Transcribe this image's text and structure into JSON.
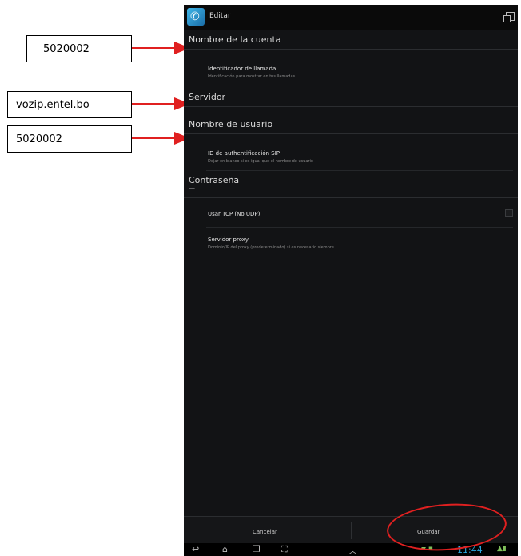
{
  "callouts": [
    {
      "text": "5020002"
    },
    {
      "text": "vozip.entel.bo"
    },
    {
      "text": "5020002"
    }
  ],
  "action_bar": {
    "title": "Editar",
    "icon": "phone-app-icon"
  },
  "categories": {
    "account_name": "Nombre de la cuenta",
    "server": "Servidor",
    "username": "Nombre de usuario",
    "password": "Contraseña",
    "password_value": "—"
  },
  "preferences": {
    "caller_id": {
      "title": "Identificador de llamada",
      "summary": "Identificación para mostrar en tus llamadas"
    },
    "sip_auth": {
      "title": "ID de authentificación SIP",
      "summary": "Dejar en blanco si es igual que el nombre de usuario"
    },
    "tcp": {
      "title": "Usar TCP (No UDP)"
    },
    "proxy": {
      "title": "Servidor proxy",
      "summary": "Dominio/IP del proxy (predeterminado) si es necesario siempre"
    }
  },
  "buttons": {
    "cancel": "Cancelar",
    "save": "Guardar"
  },
  "status": {
    "time": "11:44"
  },
  "colors": {
    "annotation_red": "#e02020",
    "screen_bg": "#121315",
    "clock_blue": "#2aa7e0"
  }
}
